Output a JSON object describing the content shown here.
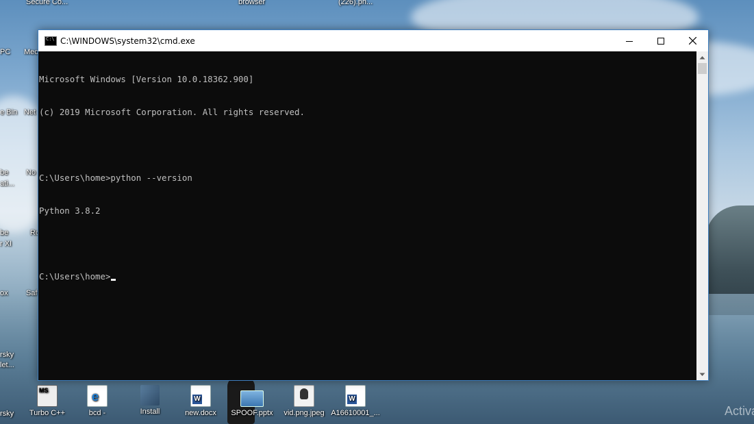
{
  "desktop": {
    "top_labels": [
      "Secure Co...",
      "browser",
      "(226).pn..."
    ],
    "left_labels": [
      "PC",
      "Mec",
      "e Bin",
      "Net",
      "be",
      "ati...",
      "No",
      "be",
      "r XI",
      "Ro",
      "ox",
      "Saf",
      "rsky",
      "let...",
      "rsky"
    ],
    "bottom_icons": [
      {
        "label": "Turbo C++",
        "icon": "turbo-cpp-icon"
      },
      {
        "label": "bcd -",
        "icon": "shortcut-ie-icon"
      },
      {
        "label": "Install",
        "icon": "install-box-icon"
      },
      {
        "label": "new.docx",
        "icon": "word-doc-icon"
      },
      {
        "label": "SPOOF.pptx",
        "icon": "pptx-file-icon"
      },
      {
        "label": "vid.png.jpeg",
        "icon": "image-file-icon"
      },
      {
        "label": "A16610001_...",
        "icon": "word-doc-icon"
      }
    ],
    "watermark": "Activa"
  },
  "window": {
    "title": "C:\\WINDOWS\\system32\\cmd.exe",
    "icon": "cmd-icon",
    "buttons": {
      "minimize": "minimize-icon",
      "maximize": "maximize-icon",
      "close": "close-icon"
    }
  },
  "console": {
    "lines": [
      "Microsoft Windows [Version 10.0.18362.900]",
      "(c) 2019 Microsoft Corporation. All rights reserved.",
      "",
      "C:\\Users\\home>python --version",
      "Python 3.8.2",
      "",
      "C:\\Users\\home>"
    ],
    "text_color": "#c0c0c0",
    "background": "#0c0c0c"
  }
}
